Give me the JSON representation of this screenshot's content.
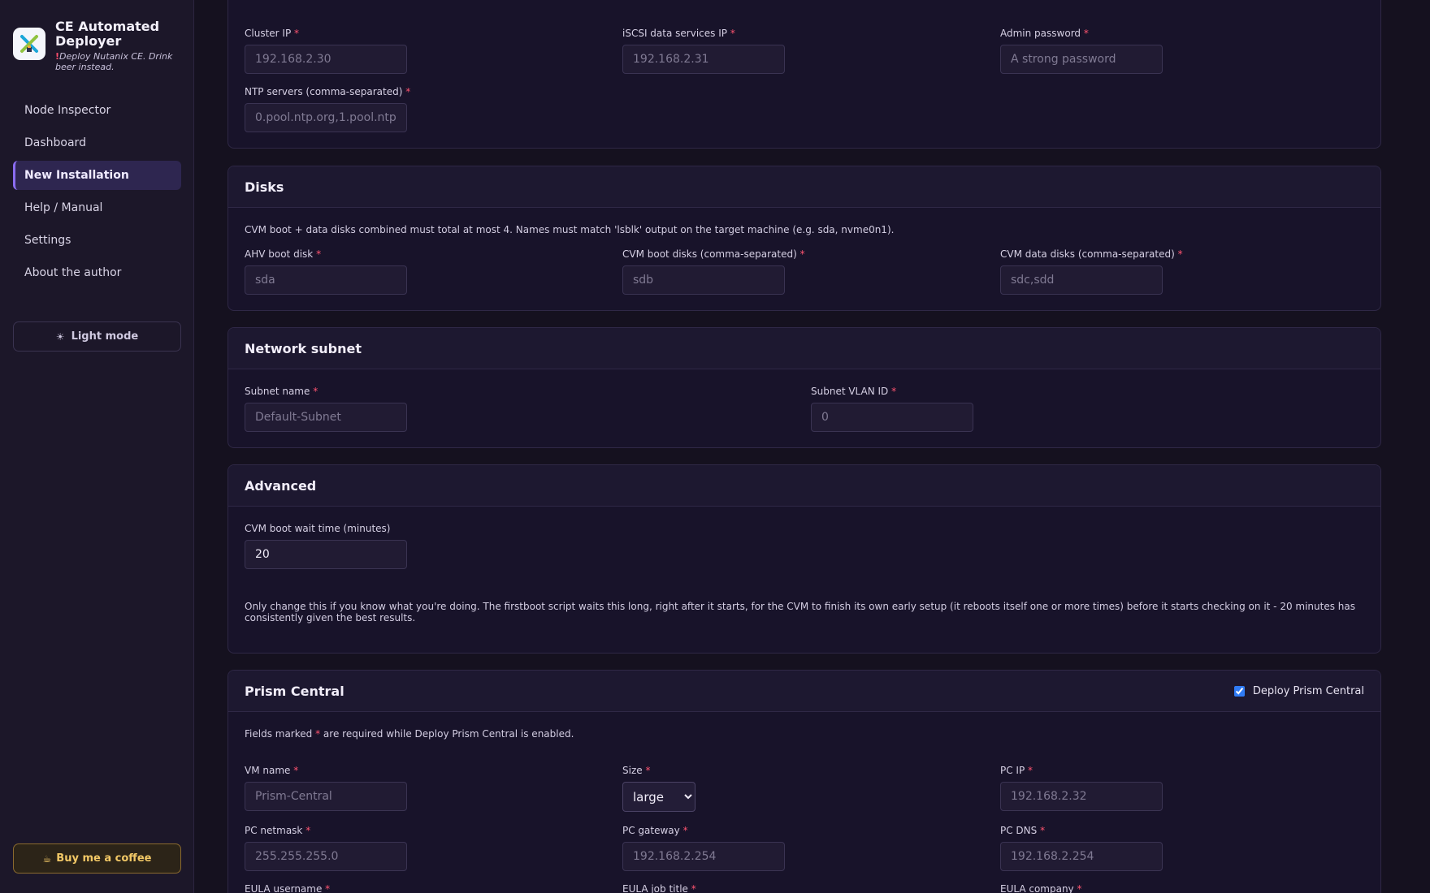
{
  "brand": {
    "title": "CE Automated Deployer",
    "tagline_mark": "!",
    "tagline": "Deploy Nutanix CE. Drink beer instead."
  },
  "nav": {
    "items": [
      {
        "label": "Node Inspector"
      },
      {
        "label": "Dashboard"
      },
      {
        "label": "New Installation",
        "active": true
      },
      {
        "label": "Help / Manual"
      },
      {
        "label": "Settings"
      },
      {
        "label": "About the author"
      }
    ]
  },
  "theme_toggle": {
    "icon": "sun-icon",
    "glyph": "☀",
    "label": "Light mode"
  },
  "coffee_button": {
    "icon": "coffee-icon",
    "glyph": "☕",
    "label": "Buy me a coffee"
  },
  "cluster": {
    "cluster_ip": {
      "label": "Cluster IP",
      "placeholder": "192.168.2.30"
    },
    "iscsi_ip": {
      "label": "iSCSI data services IP",
      "placeholder": "192.168.2.31"
    },
    "admin_password": {
      "label": "Admin password",
      "placeholder": "A strong password"
    },
    "ntp": {
      "label": "NTP servers (comma-separated)",
      "placeholder": "0.pool.ntp.org,1.pool.ntp.org"
    }
  },
  "disks": {
    "title": "Disks",
    "note": "CVM boot + data disks combined must total at most 4. Names must match 'lsblk' output on the target machine (e.g. sda, nvme0n1).",
    "ahv_boot": {
      "label": "AHV boot disk",
      "placeholder": "sda"
    },
    "cvm_boot": {
      "label": "CVM boot disks (comma-separated)",
      "placeholder": "sdb"
    },
    "cvm_data": {
      "label": "CVM data disks (comma-separated)",
      "placeholder": "sdc,sdd"
    }
  },
  "subnet": {
    "title": "Network subnet",
    "name": {
      "label": "Subnet name",
      "placeholder": "Default-Subnet"
    },
    "vlan": {
      "label": "Subnet VLAN ID",
      "placeholder": "0"
    }
  },
  "advanced": {
    "title": "Advanced",
    "wait": {
      "label": "CVM boot wait time (minutes)",
      "value": "20"
    },
    "note": "Only change this if you know what you're doing. The firstboot script waits this long, right after it starts, for the CVM to finish its own early setup (it reboots itself one or more times) before it starts checking on it - 20 minutes has consistently given the best results."
  },
  "prism": {
    "title": "Prism Central",
    "deploy_label": "Deploy Prism Central",
    "deploy_checked": true,
    "note_prefix": "Fields marked",
    "note_mark": "*",
    "note_suffix": "are required while Deploy Prism Central is enabled.",
    "vm_name": {
      "label": "VM name",
      "placeholder": "Prism-Central"
    },
    "size": {
      "label": "Size",
      "selected": "large"
    },
    "pc_ip": {
      "label": "PC IP",
      "placeholder": "192.168.2.32"
    },
    "netmask": {
      "label": "PC netmask",
      "placeholder": "255.255.255.0"
    },
    "gateway": {
      "label": "PC gateway",
      "placeholder": "192.168.2.254"
    },
    "dns": {
      "label": "PC DNS",
      "placeholder": "192.168.2.254"
    },
    "eula_username": {
      "label": "EULA username"
    },
    "eula_job_title": {
      "label": "EULA job title"
    },
    "eula_company": {
      "label": "EULA company"
    }
  },
  "required_mark": "*"
}
